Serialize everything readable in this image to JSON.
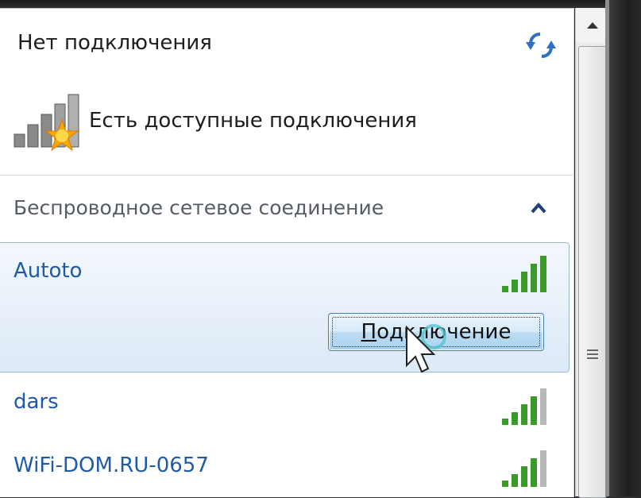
{
  "status": {
    "title": "Нет подключения"
  },
  "available": {
    "text": "Есть доступные подключения"
  },
  "section": {
    "header": "Беспроводное сетевое соединение"
  },
  "networks": [
    {
      "name": "Autoto",
      "selected": true,
      "connect_label_mnemonic": "П",
      "connect_label_rest": "одключение"
    },
    {
      "name": "dars",
      "selected": false
    },
    {
      "name": "WiFi-DOM.RU-0657",
      "selected": false
    }
  ],
  "colors": {
    "network_name": "#1f5aa8",
    "signal_green": "#3a9a2a",
    "signal_gray": "#b8b8b8",
    "selection_border": "#98b8de"
  },
  "icons": {
    "refresh": "refresh-arrows-icon",
    "collapse": "chevron-up-icon",
    "signal": "wifi-signal-bars-icon",
    "status": "network-available-star-icon",
    "scroll_up": "scroll-up-arrow-icon",
    "grip": "scroll-grip-icon",
    "cursor": "mouse-pointer-icon"
  }
}
